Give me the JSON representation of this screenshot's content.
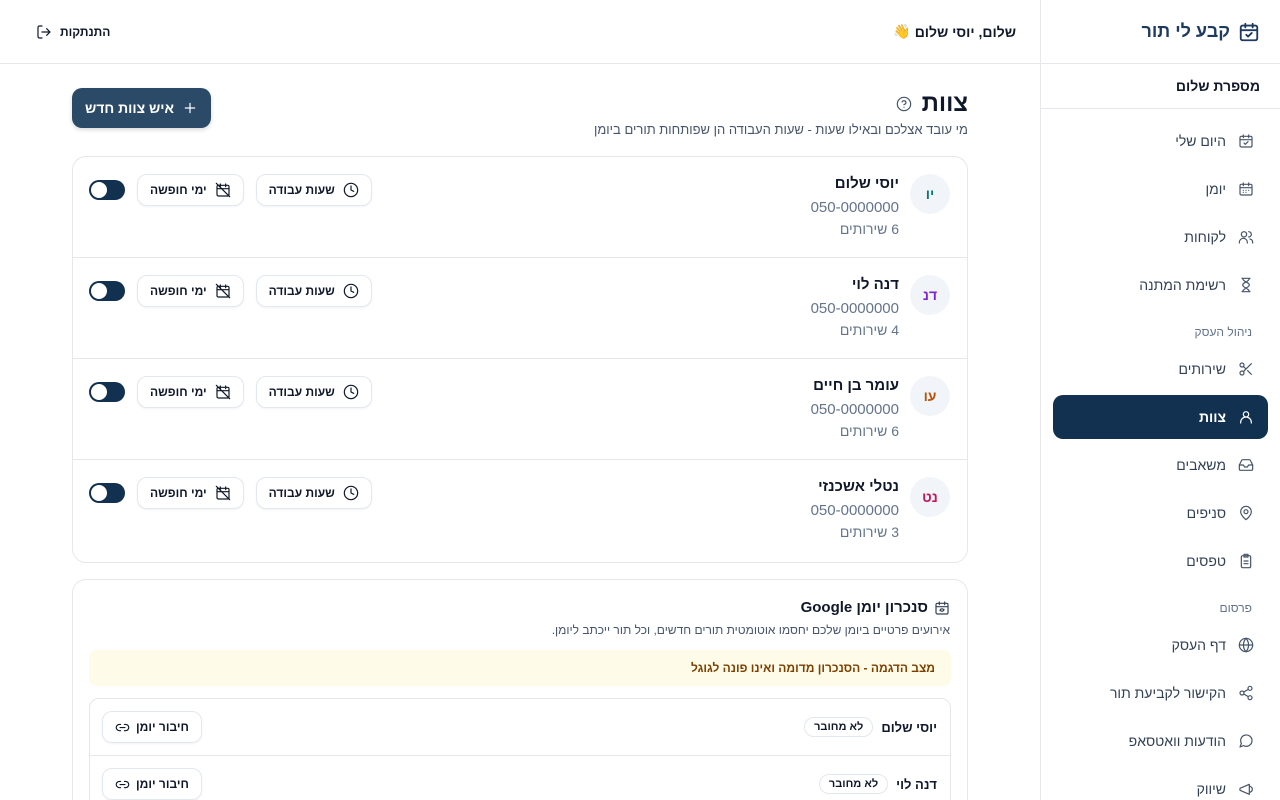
{
  "brand": {
    "name": "קבע לי תור",
    "icon": "calendar-check-icon"
  },
  "business": {
    "name": "מספרת שלום"
  },
  "topbar": {
    "greeting": "שלום, יוסי שלום",
    "wave": "👋",
    "logout_label": "התנתקות"
  },
  "nav": {
    "items": [
      {
        "label": "היום שלי",
        "icon": "calendar-check-icon"
      },
      {
        "label": "יומן",
        "icon": "calendar-icon"
      },
      {
        "label": "לקוחות",
        "icon": "users-icon"
      },
      {
        "label": "רשימת המתנה",
        "icon": "hourglass-icon"
      }
    ],
    "section_business": "ניהול העסק",
    "business_items": [
      {
        "label": "שירותים",
        "icon": "scissors-icon"
      },
      {
        "label": "צוות",
        "icon": "user-icon",
        "active": true
      },
      {
        "label": "משאבים",
        "icon": "inbox-icon"
      },
      {
        "label": "סניפים",
        "icon": "map-pin-icon"
      },
      {
        "label": "טפסים",
        "icon": "clipboard-icon"
      }
    ],
    "section_publish": "פרסום",
    "publish_items": [
      {
        "label": "דף העסק",
        "icon": "globe-icon"
      },
      {
        "label": "הקישור לקביעת תור",
        "icon": "share-icon"
      },
      {
        "label": "הודעות וואטסאפ",
        "icon": "message-icon"
      },
      {
        "label": "שיווק",
        "icon": "megaphone-icon"
      }
    ]
  },
  "page": {
    "title": "צוות",
    "subtitle": "מי עובד אצלכם ובאילו שעות - שעות העבודה הן שפותחות תורים ביומן",
    "add_button": "איש צוות חדש"
  },
  "team": {
    "hours_label": "שעות עבודה",
    "vacation_label": "ימי חופשה",
    "members": [
      {
        "initials": "יו",
        "initials_color": "#0f766e",
        "name": "יוסי שלום",
        "phone": "050-0000000",
        "services": "6 שירותים",
        "active": true
      },
      {
        "initials": "דנ",
        "initials_color": "#7e22ce",
        "name": "דנה לוי",
        "phone": "050-0000000",
        "services": "4 שירותים",
        "active": true
      },
      {
        "initials": "עו",
        "initials_color": "#b45309",
        "name": "עומר בן חיים",
        "phone": "050-0000000",
        "services": "6 שירותים",
        "active": true
      },
      {
        "initials": "נט",
        "initials_color": "#be185d",
        "name": "נטלי אשכנזי",
        "phone": "050-0000000",
        "services": "3 שירותים",
        "active": true
      }
    ]
  },
  "sync": {
    "title": "סנכרון יומן Google",
    "description": "אירועים פרטיים ביומן שלכם יחסמו אוטומטית תורים חדשים, וכל תור ייכתב ליומן.",
    "demo_banner": "מצב הדגמה - הסנכרון מדומה ואינו פונה לגוגל",
    "connect_label": "חיבור יומן",
    "rows": [
      {
        "name": "יוסי שלום",
        "status": "לא מחובר"
      },
      {
        "name": "דנה לוי",
        "status": "לא מחובר"
      }
    ]
  }
}
